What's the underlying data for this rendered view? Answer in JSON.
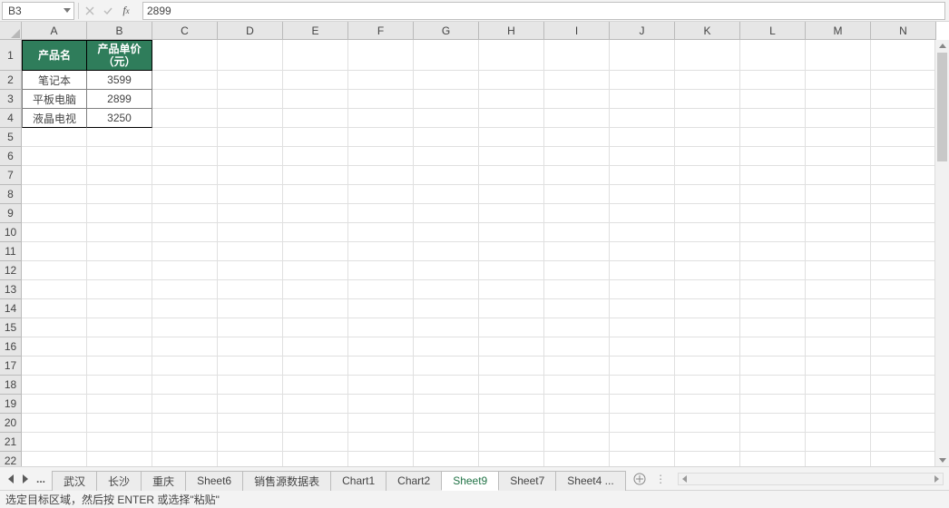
{
  "name_box": "B3",
  "formula_value": "2899",
  "columns": [
    {
      "label": "A",
      "w": 72
    },
    {
      "label": "B",
      "w": 72
    },
    {
      "label": "C",
      "w": 72
    },
    {
      "label": "D",
      "w": 72
    },
    {
      "label": "E",
      "w": 72
    },
    {
      "label": "F",
      "w": 72
    },
    {
      "label": "G",
      "w": 72
    },
    {
      "label": "H",
      "w": 72
    },
    {
      "label": "I",
      "w": 72
    },
    {
      "label": "J",
      "w": 72
    },
    {
      "label": "K",
      "w": 72
    },
    {
      "label": "L",
      "w": 72
    },
    {
      "label": "M",
      "w": 72
    },
    {
      "label": "N",
      "w": 72
    }
  ],
  "row_heights": {
    "1": 34,
    "default": 21
  },
  "row_count": 22,
  "header_cells": {
    "A1": "产品名",
    "B1": "产品单价（元）"
  },
  "data_rows": [
    {
      "A": "笔记本",
      "B": "3599"
    },
    {
      "A": "平板电脑",
      "B": "2899"
    },
    {
      "A": "液晶电视",
      "B": "3250"
    }
  ],
  "sheet_tabs": [
    {
      "label": "武汉",
      "active": false
    },
    {
      "label": "长沙",
      "active": false
    },
    {
      "label": "重庆",
      "active": false
    },
    {
      "label": "Sheet6",
      "active": false
    },
    {
      "label": "销售源数据表",
      "active": false
    },
    {
      "label": "Chart1",
      "active": false
    },
    {
      "label": "Chart2",
      "active": false
    },
    {
      "label": "Sheet9",
      "active": true
    },
    {
      "label": "Sheet7",
      "active": false
    },
    {
      "label": "Sheet4 ...",
      "active": false
    }
  ],
  "status_text": "选定目标区域，然后按 ENTER 或选择\"粘贴\""
}
